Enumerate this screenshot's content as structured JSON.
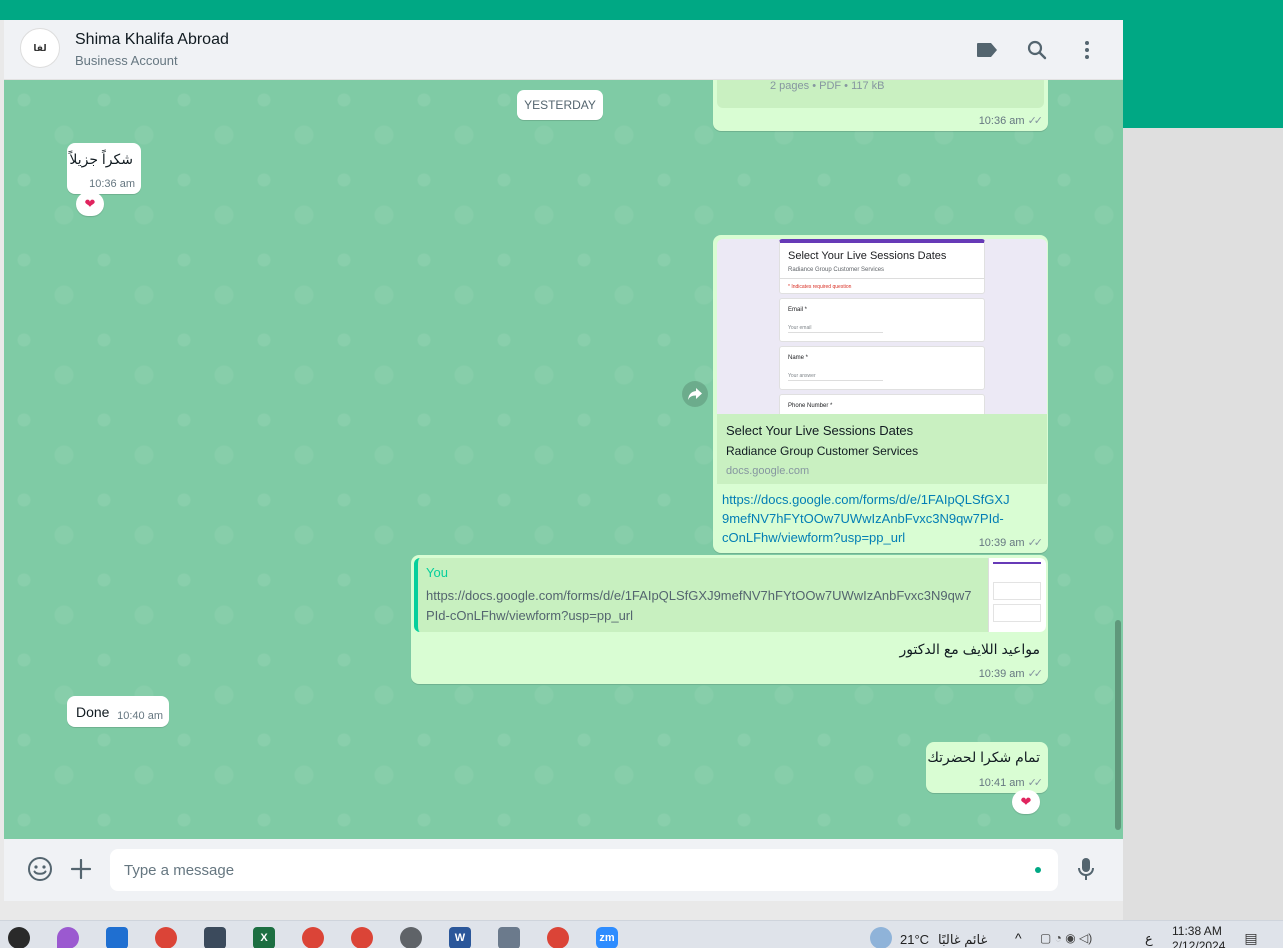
{
  "header": {
    "avatar_text": "لفا",
    "contact_name": "Shima Khalifa Abroad",
    "contact_subtitle": "Business Account"
  },
  "chat": {
    "top_doc_meta": "2 pages • PDF • 117 kB",
    "top_doc_time": "10:36 am",
    "date_divider": "YESTERDAY",
    "msg_thanks": {
      "text": "شكراً جزيلاً",
      "time": "10:36 am",
      "reaction": "❤"
    },
    "link_preview": {
      "form_title": "Select Your Live Sessions Dates",
      "form_org": "Radiance Group Customer Services",
      "form_required": "* Indicates required question",
      "field_email": "Email *",
      "field_email_hint": "Your email",
      "field_name": "Name *",
      "field_name_hint": "Your answer",
      "field_phone": "Phone Number *",
      "title": "Select Your Live Sessions Dates",
      "description": "Radiance Group Customer Services",
      "domain": "docs.google.com",
      "url": "https://docs.google.com/forms/d/e/1FAIpQLSfGXJ9mefNV7hFYtOOw7UWwIzAnbFvxc3N9qw7PId-cOnLFhw/viewform?usp=pp_url",
      "url_line1": "https://docs.google.com/forms/d/e/1FAIpQLSfGXJ",
      "url_line2": "9mefNV7hFYtOOw7UWwIzAnbFvxc3N9qw7PId-",
      "url_line3": "cOnLFhw/viewform?usp=pp_url",
      "time": "10:39 am"
    },
    "reply_msg": {
      "quote_author": "You",
      "quote_line1": "https://docs.google.com/forms/d/e/1FAIpQLSfGXJ9mefNV7hFYtOOw7UWwIzAnbFvxc3N9qw7",
      "quote_line2": "PId-cOnLFhw/viewform?usp=pp_url",
      "text": "مواعيد اللايف مع الدكتور",
      "time": "10:39 am"
    },
    "msg_done": {
      "text": "Done",
      "time": "10:40 am"
    },
    "msg_final": {
      "text": "تمام شكرا لحضرتك",
      "time": "10:41 am",
      "reaction": "❤"
    }
  },
  "composer": {
    "placeholder": "Type a message"
  },
  "taskbar": {
    "weather_temp": "21°C",
    "weather_text": "غائم غالبًا",
    "lang": "ع",
    "clock_time": "11:38 AM",
    "clock_date": "2/12/2024"
  },
  "colors": {
    "accent": "#00a884",
    "outgoing_bubble": "#d9fdd3",
    "chat_background": "#7fcba5",
    "link": "#027eb5"
  }
}
